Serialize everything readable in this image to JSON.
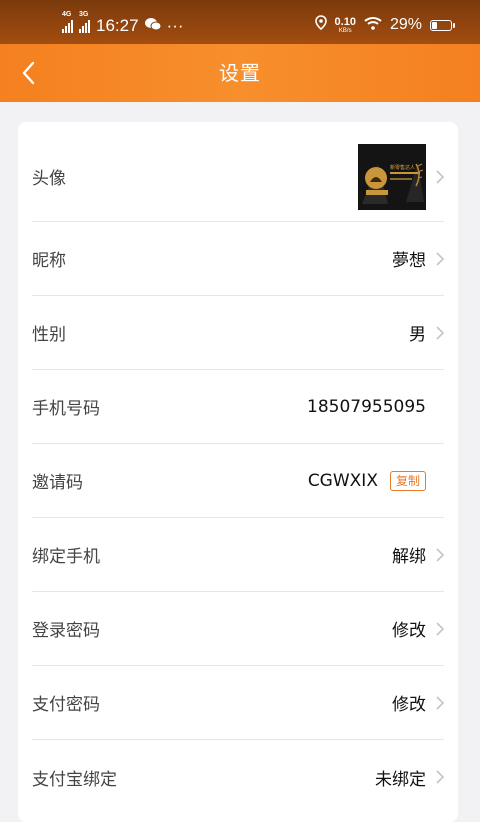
{
  "status_bar": {
    "net1": "4G",
    "net2": "3G",
    "time": "16:27",
    "more": "···",
    "speed_value": "0.10",
    "speed_unit": "KB/s",
    "battery": "29%",
    "battery_level": 0.29
  },
  "nav": {
    "title": "设置"
  },
  "avatar": {
    "image_text": "新零售达人"
  },
  "rows": [
    {
      "label": "头像",
      "value": ""
    },
    {
      "label": "昵称",
      "value": "夢想"
    },
    {
      "label": "性别",
      "value": "男"
    },
    {
      "label": "手机号码",
      "value": "18507955095"
    },
    {
      "label": "邀请码",
      "value": "CGWXIX",
      "action": "复制"
    },
    {
      "label": "绑定手机",
      "value": "解绑"
    },
    {
      "label": "登录密码",
      "value": "修改"
    },
    {
      "label": "支付密码",
      "value": "修改"
    },
    {
      "label": "支付宝绑定",
      "value": "未绑定"
    }
  ],
  "colors": {
    "accent": "#f5801f",
    "status_bar": "#8a420e",
    "copy_button": "#e87a2c"
  }
}
